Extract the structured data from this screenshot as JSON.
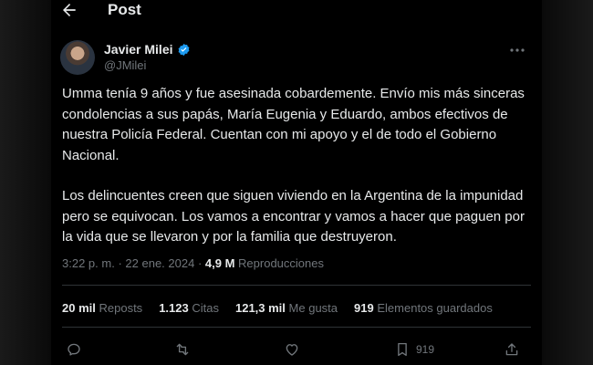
{
  "header": {
    "title": "Post"
  },
  "author": {
    "name": "Javier Milei",
    "handle": "@JMilei"
  },
  "post": {
    "paragraphs": [
      "Umma tenía 9 años y fue asesinada cobardemente. Envío mis más sinceras condolencias a sus papás, María Eugenia y Eduardo, ambos efectivos de nuestra Policía Federal. Cuentan con mi apoyo y el de todo el Gobierno Nacional.",
      "Los delincuentes creen que siguen viviendo en la Argentina de la impunidad pero se equivocan. Los vamos a encontrar y vamos a hacer que paguen por la vida que se llevaron y por la familia que destruyeron."
    ],
    "time": "3:22 p. m.",
    "separator": "·",
    "date": "22 ene. 2024",
    "views_count": "4,9 M",
    "views_label": "Reproducciones"
  },
  "stats": [
    {
      "count": "20 mil",
      "label": "Reposts"
    },
    {
      "count": "1.123",
      "label": "Citas"
    },
    {
      "count": "121,3 mil",
      "label": "Me gusta"
    },
    {
      "count": "919",
      "label": "Elementos guardados"
    }
  ],
  "actions": {
    "bookmark_count": "919",
    "icons": [
      "reply-icon",
      "repost-icon",
      "like-icon",
      "bookmark-icon",
      "share-icon"
    ]
  },
  "colors": {
    "background": "#000000",
    "text": "#e7e9ea",
    "muted": "#71767b",
    "verified": "#1d9bf0",
    "divider": "#2f3336"
  }
}
